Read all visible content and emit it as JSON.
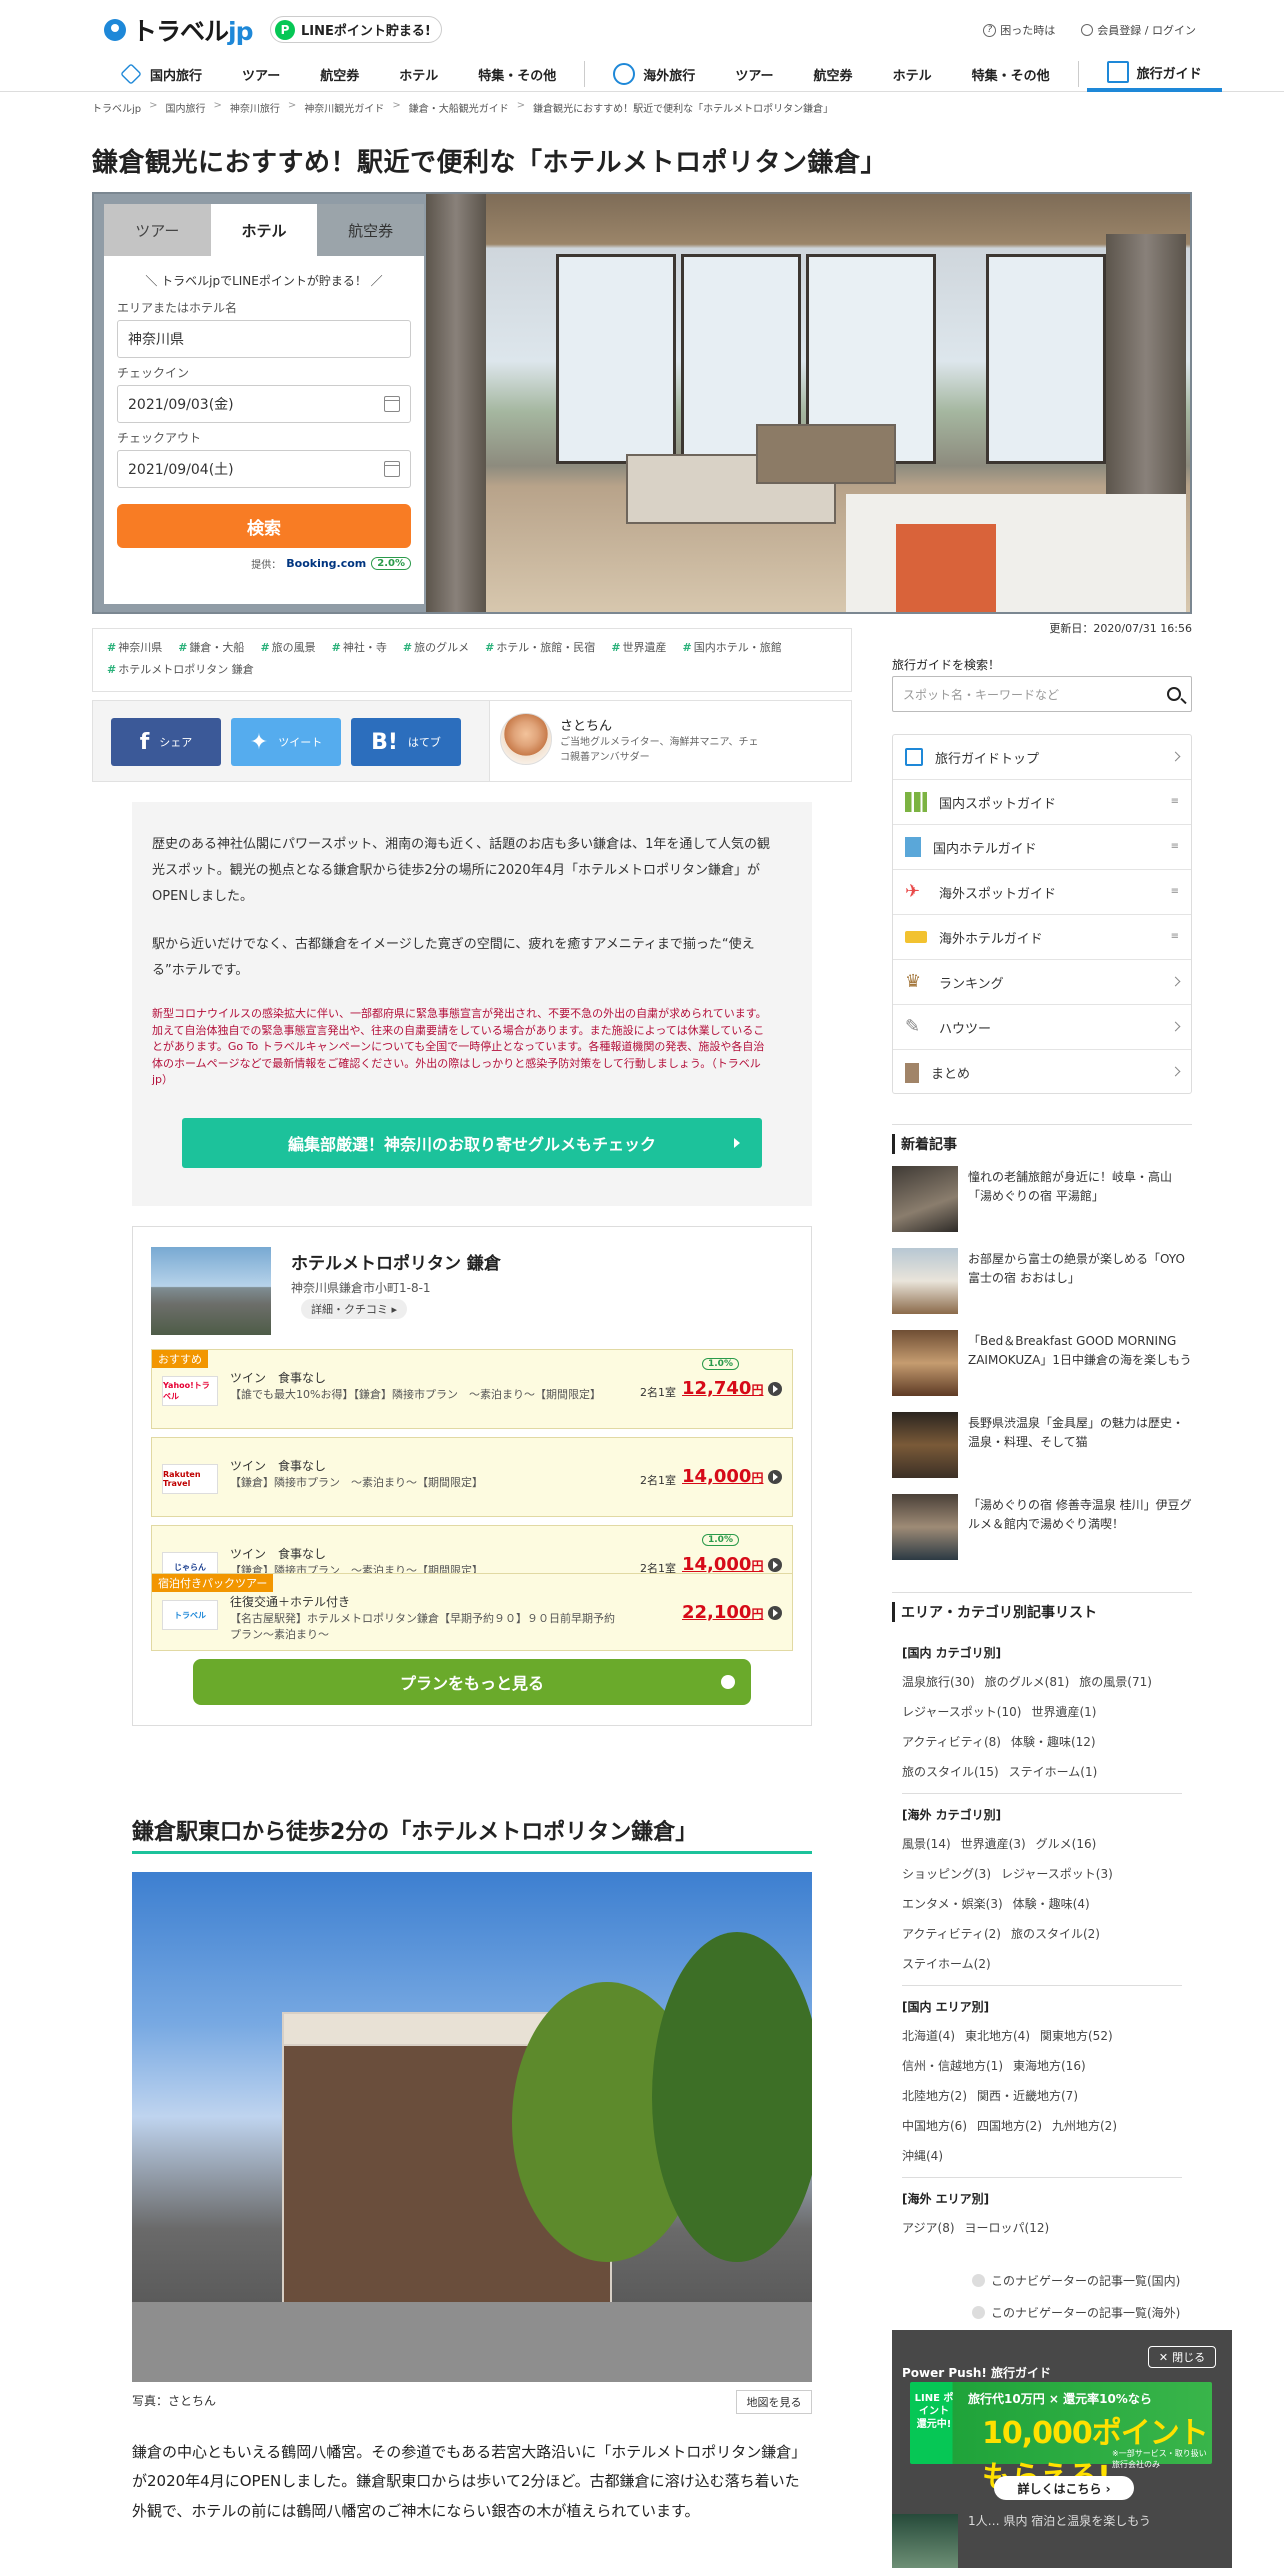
{
  "header": {
    "logo": "トラベル",
    "logo_suffix": "jp",
    "line_badge": "LINEポイント貯まる!",
    "help": "困った時は",
    "login": "会員登録 / ログイン",
    "nav": [
      "国内旅行",
      "ツアー",
      "航空券",
      "ホテル",
      "特集・その他",
      "海外旅行",
      "ツアー",
      "航空券",
      "ホテル",
      "特集・その他",
      "旅行ガイド"
    ]
  },
  "breadcrumb": [
    "トラベルjp",
    "国内旅行",
    "神奈川旅行",
    "神奈川観光ガイド",
    "鎌倉・大船観光ガイド",
    "鎌倉観光におすすめ！駅近で便利な「ホテルメトロポリタン鎌倉」"
  ],
  "title": "鎌倉観光におすすめ！駅近で便利な「ホテルメトロポリタン鎌倉」",
  "search": {
    "tabs": [
      "ツアー",
      "ホテル",
      "航空券"
    ],
    "promo": "＼ トラベルjpでLINEポイントが貯まる！ ／",
    "area_label": "エリアまたはホテル名",
    "area_value": "神奈川県",
    "checkin_label": "チェックイン",
    "checkin_value": "2021/09/03(金)",
    "checkout_label": "チェックアウト",
    "checkout_value": "2021/09/04(土)",
    "button": "検索",
    "provided_label": "提供：",
    "provider": "Booking.com",
    "rate": "2.0%"
  },
  "tags": [
    "神奈川県",
    "鎌倉・大船",
    "旅の風景",
    "神社・寺",
    "旅のグルメ",
    "ホテル・旅館・民宿",
    "世界遺産",
    "国内ホテル・旅館",
    "ホテルメトロポリタン 鎌倉"
  ],
  "updated": "更新日：2020/07/31 16:56",
  "share": {
    "facebook": "シェア",
    "twitter": "ツイート",
    "hatena": "はてブ"
  },
  "author": {
    "name": "さとちん",
    "desc": "ご当地グルメライター、海鮮丼マニア、チェコ親善アンバサダー"
  },
  "intro": {
    "p1": "歴史のある神社仏閣にパワースポット、湘南の海も近く、話題のお店も多い鎌倉は、1年を通して人気の観光スポット。観光の拠点となる鎌倉駅から徒歩2分の場所に2020年4月「ホテルメトロポリタン鎌倉」がOPENしました。",
    "p2": "駅から近いだけでなく、古都鎌倉をイメージした寛ぎの空間に、疲れを癒すアメニティまで揃った“使える”ホテルです。",
    "warn": "新型コロナウイルスの感染拡大に伴い、一部都府県に緊急事態宣言が発出され、不要不急の外出の自粛が求められています。加えて自治体独自での緊急事態宣言発出や、往来の自粛要請をしている場合があります。また施設によっては休業していることがあります。Go To トラベルキャンペーンについても全国で一時停止となっています。各種報道機関の発表、施設や各自治体のホームページなどで最新情報をご確認ください。外出の際はしっかりと感染予防対策をして行動しましょう。（トラベルjp）",
    "gourmet": "編集部厳選！神奈川のお取り寄せグルメもチェック"
  },
  "hotel": {
    "name": "ホテルメトロポリタン 鎌倉",
    "address": "神奈川県鎌倉市小町1-8-1",
    "details": "詳細・クチコミ ▸",
    "plans": [
      {
        "badge": "おすすめ",
        "logo": "Yahoo!トラベル",
        "title": "ツイン　食事なし",
        "sub": "【誰でも最大10%お得】【鎌倉】隣接市プラン　～素泊まり～【期間限定】",
        "who": "2名1室",
        "price": "12,740",
        "unit": "円",
        "pbadge": "1.0%"
      },
      {
        "badge": "",
        "logo": "Rakuten Travel",
        "title": "ツイン　食事なし",
        "sub": "【鎌倉】隣接市プラン　～素泊まり～【期間限定】",
        "who": "2名1室",
        "price": "14,000",
        "unit": "円",
        "pbadge": ""
      },
      {
        "badge": "",
        "logo": "じゃらん",
        "title": "ツイン　食事なし",
        "sub": "【鎌倉】隣接市プラン　～素泊まり～【期間限定】",
        "who": "2名1室",
        "price": "14,000",
        "unit": "円",
        "pbadge": "1.0%"
      },
      {
        "badge": "宿泊付きパックツアー",
        "logo": "トラベル",
        "title": "往復交通＋ホテル付き",
        "sub": "【名古屋駅発】ホテルメトロポリタン鎌倉【早期予約９０】９０日前早期予約プラン～素泊まり～",
        "who": "",
        "price": "22,100",
        "unit": "円",
        "pbadge": ""
      }
    ],
    "more": "プランをもっと見る"
  },
  "section": {
    "heading": "鎌倉駅東口から徒歩2分の「ホテルメトロポリタン鎌倉」",
    "caption": "写真：さとちん",
    "map": "地図を見る",
    "body": "鎌倉の中心ともいえる鶴岡八幡宮。その参道でもある若宮大路沿いに「ホテルメトロポリタン鎌倉」が2020年4月にOPENしました。鎌倉駅東口からは歩いて2分ほど。古都鎌倉に溶け込む落ち着いた外観で、ホテルの前には鶴岡八幡宮のご神木にならい銀杏の木が植えられています。"
  },
  "sidebar": {
    "search_label": "旅行ガイドを検索！",
    "search_placeholder": "スポット名・キーワードなど",
    "guide": [
      "旅行ガイドトップ",
      "国内スポットガイド",
      "国内ホテルガイド",
      "海外スポットガイド",
      "海外ホテルガイド",
      "ランキング",
      "ハウツー",
      "まとめ"
    ],
    "news_title": "新着記事",
    "news": [
      "憧れの老舗旅館が身近に！岐阜・高山「湯めぐりの宿 平湯館」",
      "お部屋から富士の絶景が楽しめる「OYO 富士の宿 おおはし」",
      "「Bed＆Breakfast GOOD MORNING ZAIMOKUZA」1日中鎌倉の海を楽しもう",
      "長野県渋温泉「金具屋」の魅力は歴史・温泉・料理、そして猫",
      "「湯めぐりの宿 修善寺温泉 桂川」伊豆グルメ＆館内で湯めぐり満喫！"
    ],
    "cat_title": "エリア・カテゴリ別記事リスト",
    "cats": [
      {
        "head": "[国内 カテゴリ別]",
        "items": [
          "温泉旅行(30)",
          "旅のグルメ(81)",
          "旅の風景(71)",
          "レジャースポット(10)",
          "世界遺産(1)",
          "アクティビティ(8)",
          "体験・趣味(12)",
          "旅のスタイル(15)",
          "ステイホーム(1)"
        ]
      },
      {
        "head": "[海外 カテゴリ別]",
        "items": [
          "風景(14)",
          "世界遺産(3)",
          "グルメ(16)",
          "ショッピング(3)",
          "レジャースポット(3)",
          "エンタメ・娯楽(3)",
          "体験・趣味(4)",
          "アクティビティ(2)",
          "旅のスタイル(2)",
          "ステイホーム(2)"
        ]
      },
      {
        "head": "[国内 エリア別]",
        "items": [
          "北海道(4)",
          "東北地方(4)",
          "関東地方(52)",
          "信州・信越地方(1)",
          "東海地方(16)",
          "北陸地方(2)",
          "関西・近畿地方(7)",
          "中国地方(6)",
          "四国地方(2)",
          "九州地方(2)",
          "沖縄(4)"
        ]
      },
      {
        "head": "[海外 エリア別]",
        "items": [
          "アジア(8)",
          "ヨーロッパ(12)"
        ]
      }
    ],
    "navlinks": [
      "このナビゲーターの記事一覧(国内)",
      "このナビゲーターの記事一覧(海外)"
    ]
  },
  "overlay": {
    "close": "閉じる",
    "title": "Power Push! 旅行ガイド",
    "line_label": "LINE ポイント 還元中!",
    "banner1": "旅行代10万円 × 還元率10%なら",
    "banner2": "10,000ポイントもらえる!",
    "banner3": "※一部サービス・取り扱い旅行会社のみ",
    "detail": "詳しくはこちら ›",
    "news": "1人… 県内 宿泊と温泉を楽しもう"
  }
}
